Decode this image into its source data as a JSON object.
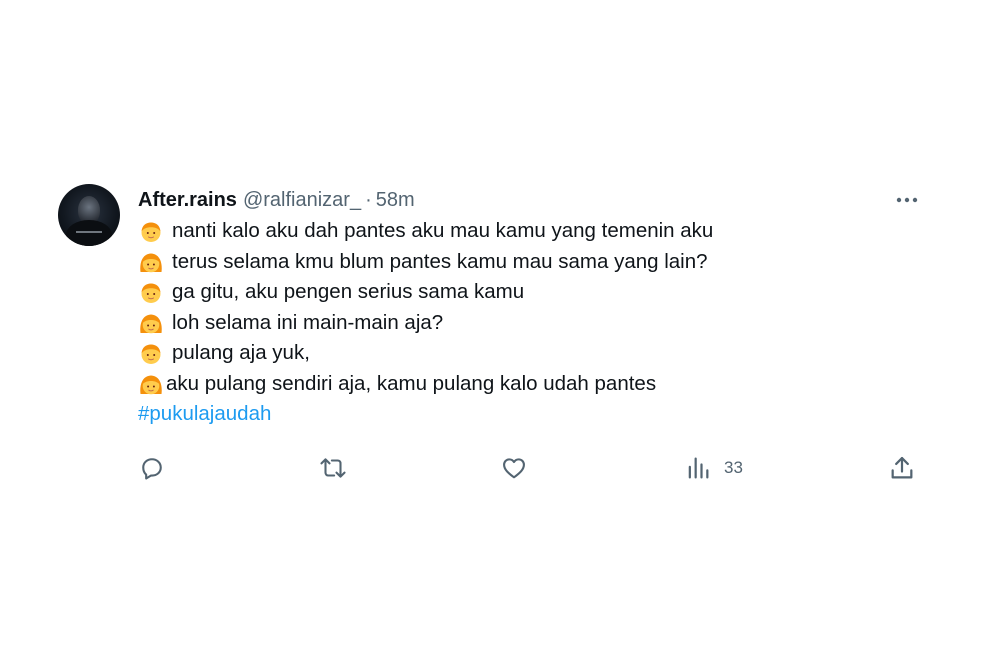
{
  "tweet": {
    "author_name": "After.rains",
    "handle": "@ralfianizar_",
    "separator": "·",
    "time": "58m",
    "lines": [
      {
        "emoji": "boy-emoji",
        "text": "nanti kalo aku dah pantes aku mau kamu yang temenin aku"
      },
      {
        "emoji": "girl-emoji",
        "text": "terus selama kmu blum pantes kamu mau sama yang lain?"
      },
      {
        "emoji": "boy-emoji",
        "text": "ga gitu, aku pengen serius sama kamu"
      },
      {
        "emoji": "girl-emoji",
        "text": "loh selama ini main-main aja?"
      },
      {
        "emoji": "boy-emoji",
        "text": "pulang aja yuk,"
      },
      {
        "emoji": "girl-emoji",
        "text": "aku pulang sendiri aja, kamu pulang kalo udah pantes"
      }
    ],
    "hashtag": "#pukulajaudah",
    "views_count": "33"
  },
  "icons": {
    "more": "more-horizontal-icon",
    "reply": "reply-icon",
    "retweet": "retweet-icon",
    "like": "heart-icon",
    "views": "analytics-icon",
    "share": "share-icon"
  },
  "colors": {
    "text": "#0f1419",
    "muted": "#536471",
    "link": "#1d9bf0",
    "emoji_skin": "#ffcc4d",
    "emoji_hair": "#f4900c"
  }
}
